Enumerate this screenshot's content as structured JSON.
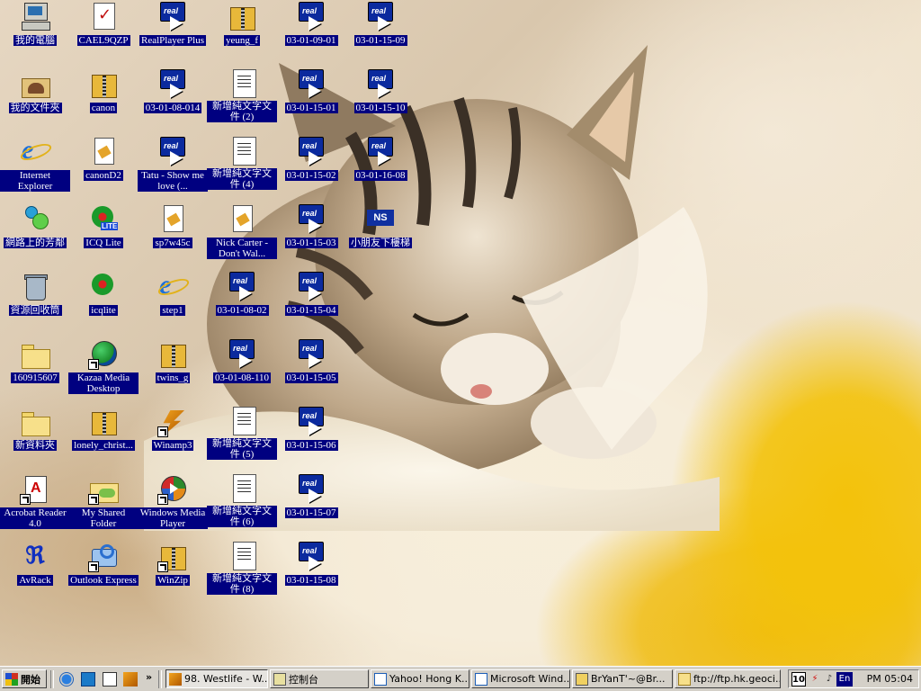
{
  "desktop": {
    "icons": {
      "c0r0": "我的電腦",
      "c0r1": "我的文件夾",
      "c0r2": "Internet Explorer",
      "c0r3": "網路上的芳鄰",
      "c0r4": "資源回收筒",
      "c0r5": "160915607",
      "c0r6": "新資料夾",
      "c0r7": "Acrobat Reader 4.0",
      "c0r8": "AvRack",
      "c1r0": "CAEL9QZP",
      "c1r1": "canon",
      "c1r2": "canonD2",
      "c1r3": "ICQ Lite",
      "c1r4": "icqlite",
      "c1r5": "Kazaa Media Desktop",
      "c1r6": "lonely_christ...",
      "c1r7": "My Shared Folder",
      "c1r8": "Outlook Express",
      "c2r0": "RealPlayer Plus",
      "c2r1": "03-01-08-014",
      "c2r2": "Tatu - Show me love (...",
      "c2r3": "sp7w45c",
      "c2r4": "step1",
      "c2r5": "twins_g",
      "c2r6": "Winamp3",
      "c2r7": "Windows Media Player",
      "c2r8": "WinZip",
      "c3r0": "yeung_f",
      "c3r1": "新增純文字文件 (2)",
      "c3r2": "新增純文字文件 (4)",
      "c3r3": "Nick Carter - Don't Wal...",
      "c3r4": "03-01-08-02",
      "c3r5": "03-01-08-110",
      "c3r6": "新增純文字文件 (5)",
      "c3r7": "新增純文字文件 (6)",
      "c3r8": "新增純文字文件 (8)",
      "c4r0": "03-01-09-01",
      "c4r1": "03-01-15-01",
      "c4r2": "03-01-15-02",
      "c4r3": "03-01-15-03",
      "c4r4": "03-01-15-04",
      "c4r5": "03-01-15-05",
      "c4r6": "03-01-15-06",
      "c4r7": "03-01-15-07",
      "c4r8": "03-01-15-08",
      "c5r0": "03-01-15-09",
      "c5r1": "03-01-15-10",
      "c5r2": "03-01-16-08",
      "c5r3": "小朋友下樓梯",
      "real_logo": "real",
      "icq_badge": "LITE",
      "ns_logo": "NS"
    }
  },
  "taskbar": {
    "start_label": "開始",
    "chevron": "»",
    "tasks": {
      "t1": "98. Westlife - W...",
      "t2": "控制台",
      "t3": "Yahoo! Hong K...",
      "t4": "Microsoft Wind...",
      "t5": "BrYanT'~@Br...",
      "t6": "ftp://ftp.hk.geoci..."
    },
    "tray": {
      "badge": "10",
      "lang": "En",
      "clock": "PM 05:04"
    }
  },
  "colors": {
    "label_bg": "#000080",
    "taskbar_bg": "#d4d0c8"
  }
}
